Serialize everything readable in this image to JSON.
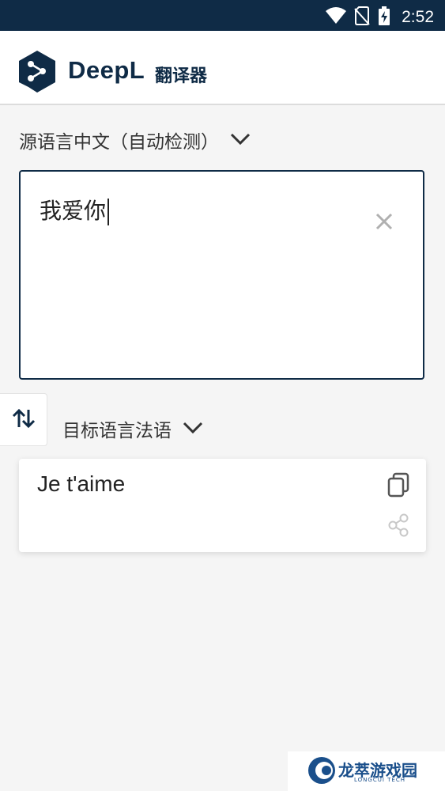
{
  "status_bar": {
    "time": "2:52",
    "icons": [
      "wifi-icon",
      "no-sim-icon",
      "battery-charging-icon"
    ]
  },
  "app_bar": {
    "brand": "DeepL",
    "subtitle": "翻译器",
    "logo_icon": "deepl-logo-icon"
  },
  "source": {
    "language_label": "源语言中文（自动检测）",
    "input_text": "我爱你"
  },
  "target": {
    "language_label": "目标语言法语",
    "output_text": "Je t'aime"
  },
  "watermark": {
    "name": "龙萃游戏园",
    "sub": "LONGCUI TECH"
  },
  "colors": {
    "brand": "#0f2b46",
    "background": "#f5f5f5"
  }
}
